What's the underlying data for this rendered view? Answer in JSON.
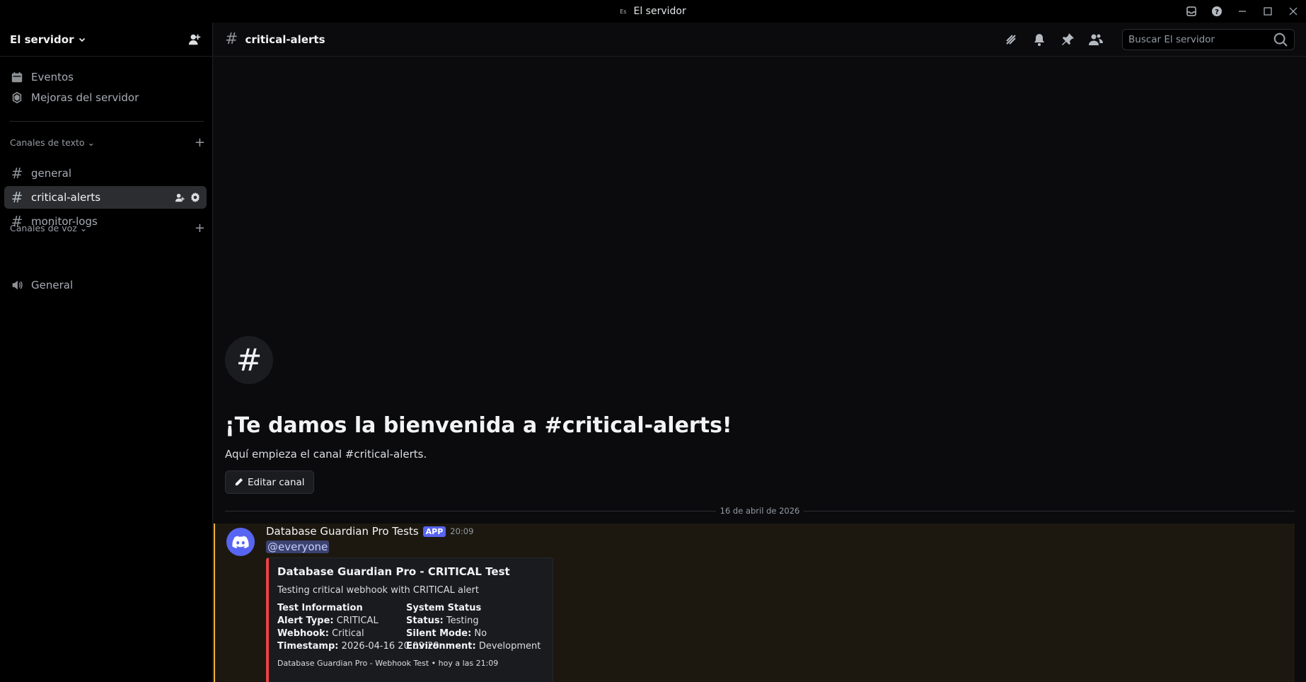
{
  "window": {
    "title": "El servidor",
    "server_glyph": "Es"
  },
  "sidebar": {
    "server_name": "El servidor",
    "top_items": [
      {
        "label": "Eventos",
        "icon": "calendar-icon"
      },
      {
        "label": "Mejoras del servidor",
        "icon": "boost-shield-icon"
      }
    ],
    "text_category": "Canales de texto",
    "text_channels": [
      {
        "label": "general"
      },
      {
        "label": "critical-alerts",
        "active": true
      },
      {
        "label": "monitor-logs"
      }
    ],
    "voice_category": "Canales de voz",
    "voice_channels": [
      {
        "label": "General"
      }
    ]
  },
  "channel": {
    "name": "critical-alerts",
    "search_placeholder": "Buscar El servidor",
    "welcome_title": "¡Te damos la bienvenida a #critical-alerts!",
    "welcome_sub": "Aquí empieza el canal #critical-alerts.",
    "edit_button": "Editar canal",
    "date_divider": "16 de abril de 2026"
  },
  "message": {
    "author": "Database Guardian Pro Tests",
    "badge": "APP",
    "time": "20:09",
    "mention": "@everyone",
    "embed": {
      "accent_color": "#ed4245",
      "title": "Database Guardian Pro - CRITICAL Test",
      "description": "Testing critical webhook with CRITICAL alert",
      "fields": [
        {
          "name": "Test Information",
          "lines": [
            {
              "key": "Alert Type:",
              "value": "CRITICAL"
            },
            {
              "key": "Webhook:",
              "value": "Critical"
            },
            {
              "key": "Timestamp:",
              "value": "2026-04-16 20:09:29"
            }
          ]
        },
        {
          "name": "System Status",
          "lines": [
            {
              "key": "Status:",
              "value": "Testing"
            },
            {
              "key": "Silent Mode:",
              "value": "No"
            },
            {
              "key": "Environment:",
              "value": "Development"
            }
          ]
        }
      ],
      "footer": "Database Guardian Pro - Webhook Test • hoy a las 21:09"
    }
  },
  "colors": {
    "mention_highlight": "#f0b232",
    "brand": "#5865f2"
  }
}
